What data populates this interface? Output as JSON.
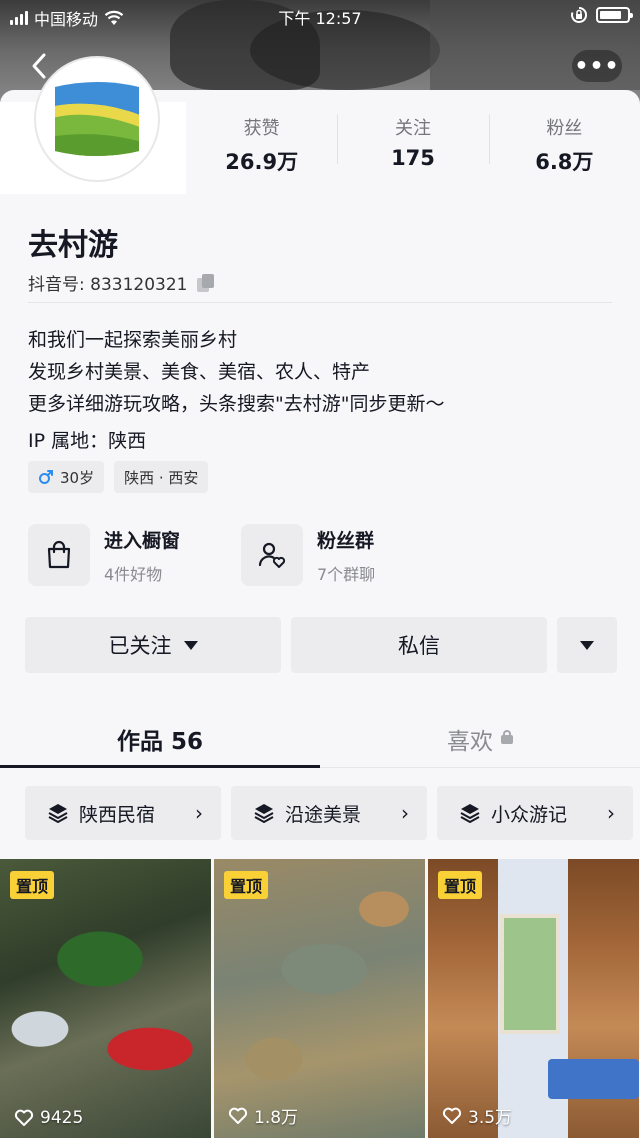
{
  "status_bar": {
    "carrier": "中国移动",
    "time": "下午 12:57"
  },
  "profile": {
    "name": "去村游",
    "douyin_id_label": "抖音号: 833120321"
  },
  "stats": [
    {
      "label": "获赞",
      "value": "26.9万"
    },
    {
      "label": "关注",
      "value": "175"
    },
    {
      "label": "粉丝",
      "value": "6.8万"
    }
  ],
  "bio": {
    "line1": "和我们一起探索美丽乡村",
    "line2": "发现乡村美景、美食、美宿、农人、特产",
    "line3": "更多详细游玩攻略，头条搜索\"去村游\"同步更新～",
    "ip": "IP 属地：陕西"
  },
  "tags": {
    "age": "30岁",
    "location": "陕西 · 西安"
  },
  "entries": [
    {
      "title": "进入橱窗",
      "subtitle": "4件好物",
      "icon": "shopping-bag-icon"
    },
    {
      "title": "粉丝群",
      "subtitle": "7个群聊",
      "icon": "fan-group-icon"
    }
  ],
  "actions": {
    "follow_label": "已关注",
    "message_label": "私信"
  },
  "tabs": {
    "works": "作品 56",
    "likes": "喜欢"
  },
  "collections": [
    {
      "label": "陕西民宿"
    },
    {
      "label": "沿途美景"
    },
    {
      "label": "小众游记"
    }
  ],
  "videos": [
    {
      "pin": "置顶",
      "likes": "9425"
    },
    {
      "pin": "置顶",
      "likes": "1.8万"
    },
    {
      "pin": "置顶",
      "likes": "3.5万"
    }
  ],
  "colors": {
    "accent_pin": "#f9d137",
    "male_icon": "#2d8cf0",
    "text_primary": "#161823"
  }
}
